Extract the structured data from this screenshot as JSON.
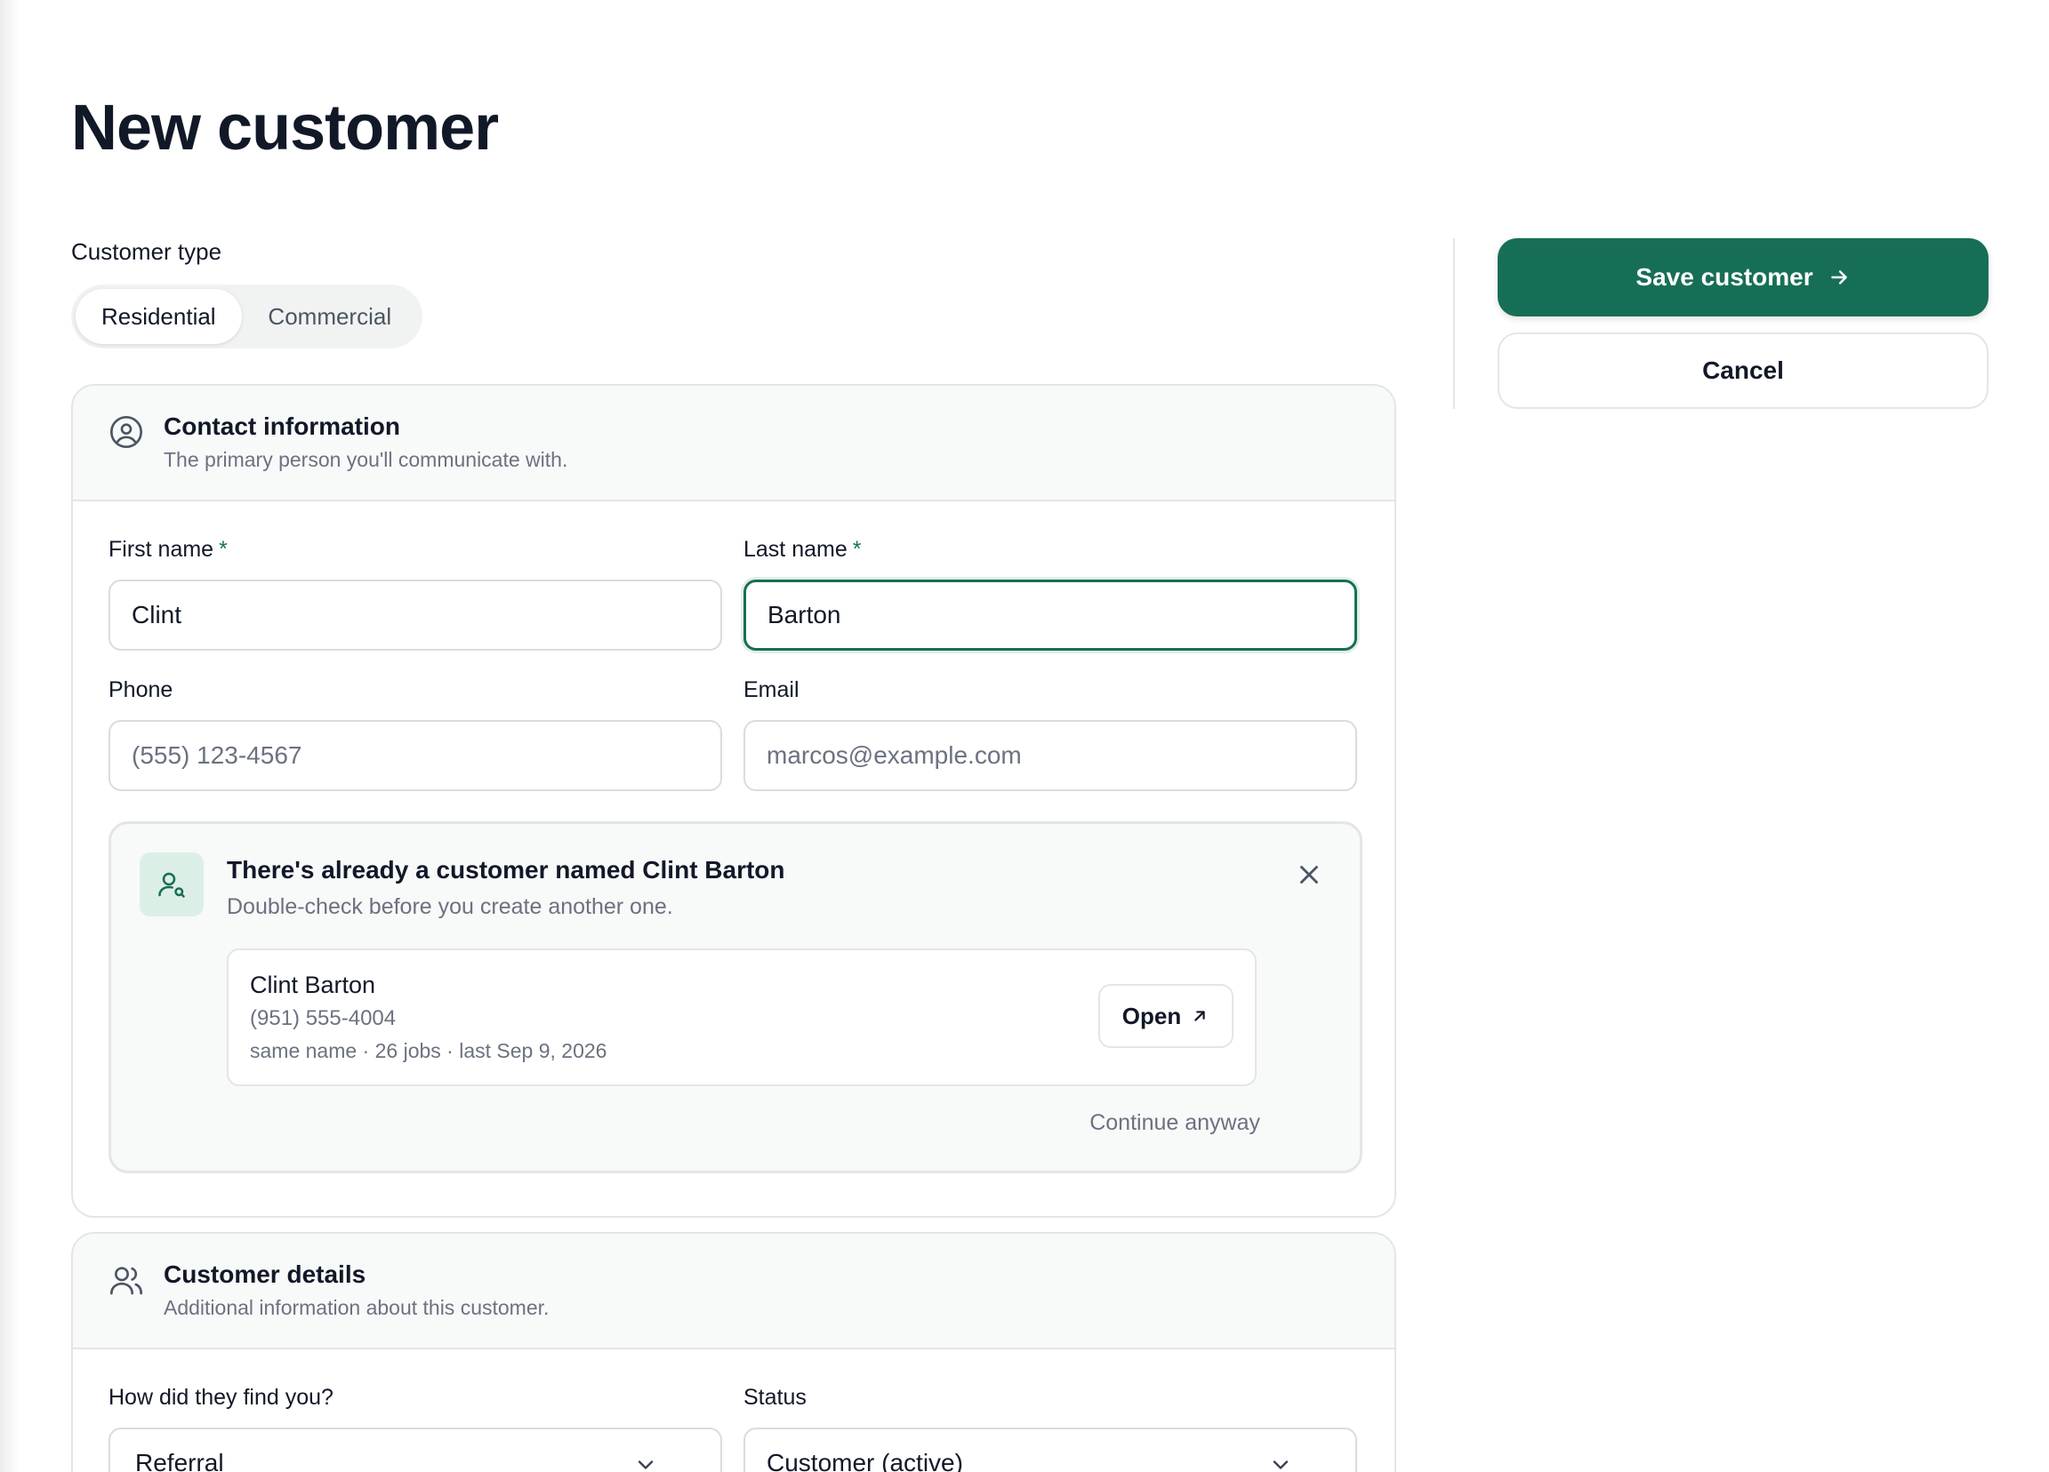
{
  "page": {
    "title": "New customer"
  },
  "customer_type": {
    "label": "Customer type",
    "options": [
      "Residential",
      "Commercial"
    ],
    "selected": "Residential"
  },
  "contact": {
    "title": "Contact information",
    "subtitle": "The primary person you'll communicate with.",
    "first_name": {
      "label": "First name",
      "required": "*",
      "value": "Clint"
    },
    "last_name": {
      "label": "Last name",
      "required": "*",
      "value": "Barton"
    },
    "phone": {
      "label": "Phone",
      "placeholder": "(555) 123-4567"
    },
    "email": {
      "label": "Email",
      "placeholder": "marcos@example.com"
    }
  },
  "duplicate": {
    "title": "There's already a customer named Clint Barton",
    "subtitle": "Double-check before you create another one.",
    "match": {
      "name": "Clint Barton",
      "phone": "(951) 555-4004",
      "meta": "same name · 26 jobs · last Sep 9, 2026",
      "open_label": "Open"
    },
    "continue_label": "Continue anyway"
  },
  "details": {
    "title": "Customer details",
    "subtitle": "Additional information about this customer.",
    "source": {
      "label": "How did they find you?",
      "value": "Referral"
    },
    "status": {
      "label": "Status",
      "value": "Customer (active)"
    }
  },
  "actions": {
    "save_label": "Save customer",
    "cancel_label": "Cancel"
  },
  "colors": {
    "accent": "#176e56",
    "accent_light": "#dcefe7",
    "border": "#e3e6e5"
  }
}
